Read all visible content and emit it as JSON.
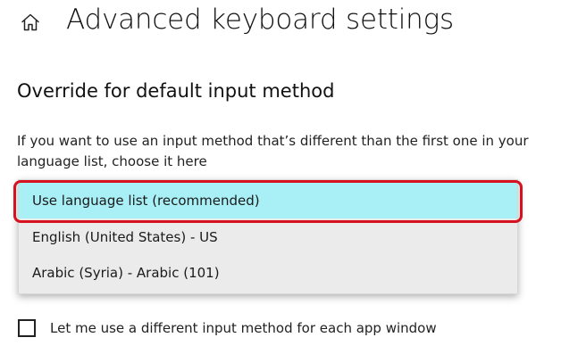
{
  "header": {
    "home_icon": "home-icon",
    "title": "Advanced keyboard settings"
  },
  "override_section": {
    "title": "Override for default input method",
    "description": "If you want to use an input method that’s different than the first one in your language list, choose it here",
    "dropdown": {
      "selected_index": 0,
      "options": [
        {
          "label": "Use language list (recommended)"
        },
        {
          "label": "English (United States) - US"
        },
        {
          "label": "Arabic (Syria) - Arabic (101)"
        }
      ]
    }
  },
  "per_app_checkbox": {
    "label": "Let me use a different input method for each app window",
    "checked": false
  },
  "colors": {
    "selected_option_background": "#a9f0f6",
    "annotation_outline": "#d61220",
    "dropdown_background": "#ebebeb"
  }
}
